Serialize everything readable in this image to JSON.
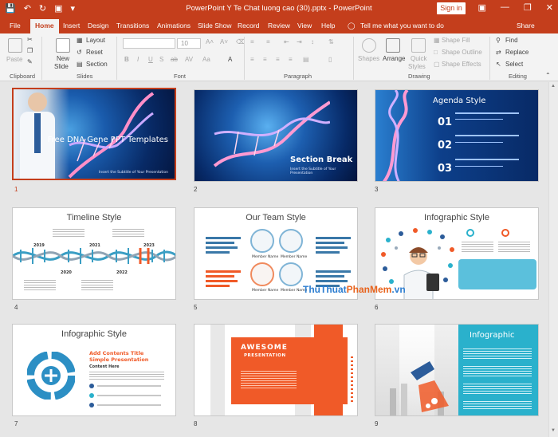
{
  "window": {
    "title": "PowerPoint Y Te Chat luong cao (30).pptx  -  PowerPoint",
    "signin": "Sign in"
  },
  "menu": {
    "tabs": [
      "File",
      "Home",
      "Insert",
      "Design",
      "Transitions",
      "Animations",
      "Slide Show",
      "Record",
      "Review",
      "View",
      "Help"
    ],
    "tell_me": "Tell me what you want to do",
    "share": "Share"
  },
  "ribbon": {
    "clipboard": {
      "paste": "Paste",
      "label": "Clipboard"
    },
    "slides": {
      "new_slide": "New",
      "new_slide2": "Slide",
      "layout": "Layout",
      "reset": "Reset",
      "section": "Section",
      "label": "Slides"
    },
    "font": {
      "size": "10",
      "label": "Font"
    },
    "paragraph": {
      "label": "Paragraph"
    },
    "drawing": {
      "shapes": "Shapes",
      "arrange": "Arrange",
      "quick": "Quick",
      "styles": "Styles",
      "shape_fill": "Shape Fill",
      "shape_outline": "Shape Outline",
      "shape_effects": "Shape Effects",
      "label": "Drawing"
    },
    "editing": {
      "find": "Find",
      "replace": "Replace",
      "select": "Select",
      "label": "Editing"
    }
  },
  "slides": [
    {
      "num": "1",
      "title": "Free DNA Gene PPT Templates",
      "subtitle": "Insert the Subtitle of Your Presentation"
    },
    {
      "num": "2",
      "title": "Section Break",
      "subtitle": "Insert the Subtitle of Your Presentation"
    },
    {
      "num": "3",
      "title": "Agenda Style",
      "items": [
        "01",
        "02",
        "03"
      ]
    },
    {
      "num": "4",
      "title": "Timeline Style",
      "years": [
        "2019",
        "2020",
        "2021",
        "2022",
        "2023"
      ]
    },
    {
      "num": "5",
      "title": "Our Team Style",
      "member": "Member Name"
    },
    {
      "num": "6",
      "title": "Infographic Style"
    },
    {
      "num": "7",
      "title": "Infographic Style",
      "heading": "Add Contents Title",
      "heading2": "Simple Presentation",
      "sub": "Content Here"
    },
    {
      "num": "8",
      "title": "AWESOME",
      "title2": "PRESENTATION"
    },
    {
      "num": "9",
      "title": "Infographic"
    }
  ],
  "watermark": {
    "a": "ThuThuat",
    "b": "PhanMem",
    "c": ".vn"
  },
  "colors": {
    "accent": "#c43e1c",
    "orange": "#f05a28",
    "teal": "#2ab1cc"
  }
}
